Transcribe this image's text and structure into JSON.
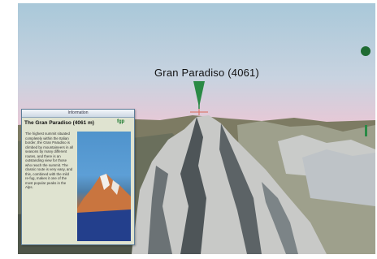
{
  "map": {
    "peak_label": "Gran Paradiso (4061)"
  },
  "info_panel": {
    "window_title": "Information",
    "heading": "The Gran Paradiso (4061 m)",
    "logo_text": "fgp",
    "body": "The highest summit situated completely within the Italian border, the Gran Paradiso is climbed by mountaineers in all seasons by many different routes, and there is an outstanding view for those who reach the summit. The classic route is very easy, and this, combined with the mild re-fug, makes it one of the most popular peaks in the Alps."
  },
  "colors": {
    "marker_pin": "#2a8a45",
    "marker_ball": "#1e6b32"
  }
}
